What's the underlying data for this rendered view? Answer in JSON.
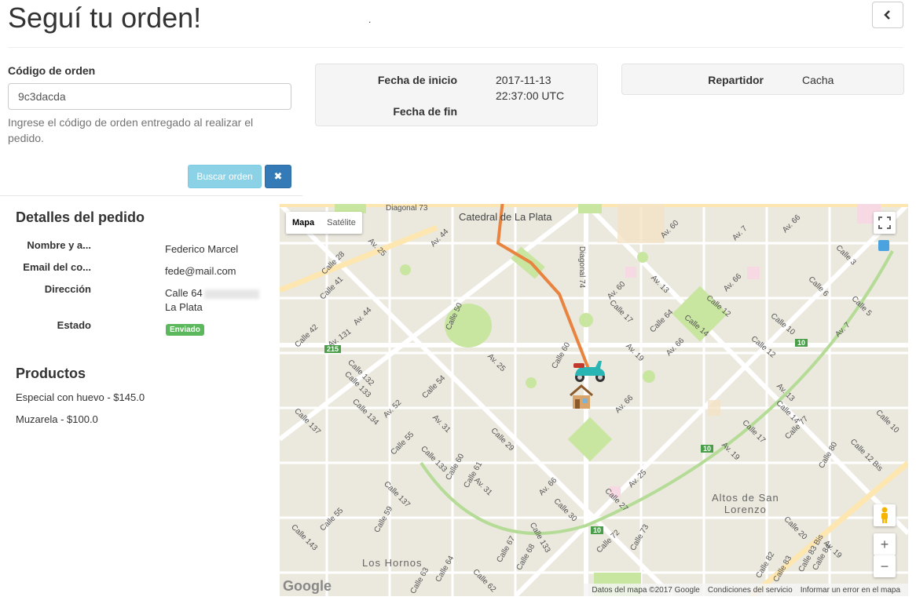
{
  "header": {
    "title": "Seguí tu orden!",
    "mark": "."
  },
  "order": {
    "label": "Código de orden",
    "value": "9c3dacda",
    "help": "Ingrese el código de orden entregado al realizar el pedido.",
    "search_label": "Buscar orden",
    "clear_icon": "✖"
  },
  "dates": {
    "start_label": "Fecha de inicio",
    "start_value_date": "2017-11-13",
    "start_value_time": "22:37:00 UTC",
    "end_label": "Fecha de fin",
    "end_value": ""
  },
  "courier": {
    "label": "Repartidor",
    "value": "Cacha"
  },
  "details": {
    "title": "Detalles del pedido",
    "name_label": "Nombre y a...",
    "name_value": "Federico Marcel",
    "email_label": "Email del co...",
    "email_value": "fede@mail.com",
    "address_label": "Dirección",
    "address_line1": "Calle 64",
    "address_line2": "La Plata",
    "status_label": "Estado",
    "status_value": "Enviado"
  },
  "products": {
    "title": "Productos",
    "items": [
      "Especial con huevo - $145.0",
      "Muzarela - $100.0"
    ]
  },
  "map": {
    "type_map": "Mapa",
    "type_satellite": "Satélite",
    "zoom_in": "+",
    "zoom_out": "−",
    "logo": "Google",
    "footer_data": "Datos del mapa ©2017 Google",
    "footer_terms": "Condiciones del servicio",
    "footer_report": "Informar un error en el mapa",
    "places": {
      "cathedral": "Catedral de La Plata",
      "altos_line1": "Altos de San",
      "altos_line2": "Lorenzo",
      "hornos": "Los Hornos"
    },
    "street_labels": [
      "Diagonal 73",
      "Av. 44",
      "Av. 25",
      "Calle 28",
      "Calle 41",
      "Av. 44",
      "Calle 42",
      "Av. 131",
      "Calle 132",
      "Calle 133",
      "Calle 134",
      "Av. 52",
      "Calle 137",
      "Calle 55",
      "Calle 54",
      "Av. 25",
      "Av. 31",
      "Calle 50",
      "Diagonal 74",
      "Av. 60",
      "Av. 13",
      "Calle 17",
      "Calle 64",
      "Av. 19",
      "Av. 66",
      "Calle 60",
      "Av. 66",
      "Calle 12",
      "Calle 14",
      "Av. 66",
      "Calle 10",
      "Av. 7",
      "Calle 6",
      "Calle 5",
      "Calle 3",
      "Av. 7",
      "Av. 66",
      "Av. 60",
      "Calle 12",
      "Av. 13",
      "Calle 14",
      "Calle 77",
      "Calle 17",
      "Av. 19",
      "Calle 80",
      "Calle 12 Bis",
      "Calle 10",
      "Calle 29",
      "Av. 66",
      "Calle 30",
      "Calle 27",
      "Av. 25",
      "Calle 72",
      "Calle 73",
      "Calle 20",
      "Calle 83 Bis",
      "Calle 84",
      "Av. 19",
      "Calle 133",
      "Calle 60",
      "Calle 61",
      "Calle 137",
      "Calle 59",
      "Calle 143",
      "Calle 55",
      "Calle 64",
      "Calle 63",
      "Calle 67",
      "Calle 68",
      "Calle 133",
      "Av. 31",
      "Calle 62",
      "Calle 82",
      "Calle 83"
    ],
    "route_badges": [
      "215",
      "10",
      "10",
      "10"
    ],
    "legend": {
      "route_color": "#e8843f",
      "park_color": "#c8e6a0"
    }
  }
}
